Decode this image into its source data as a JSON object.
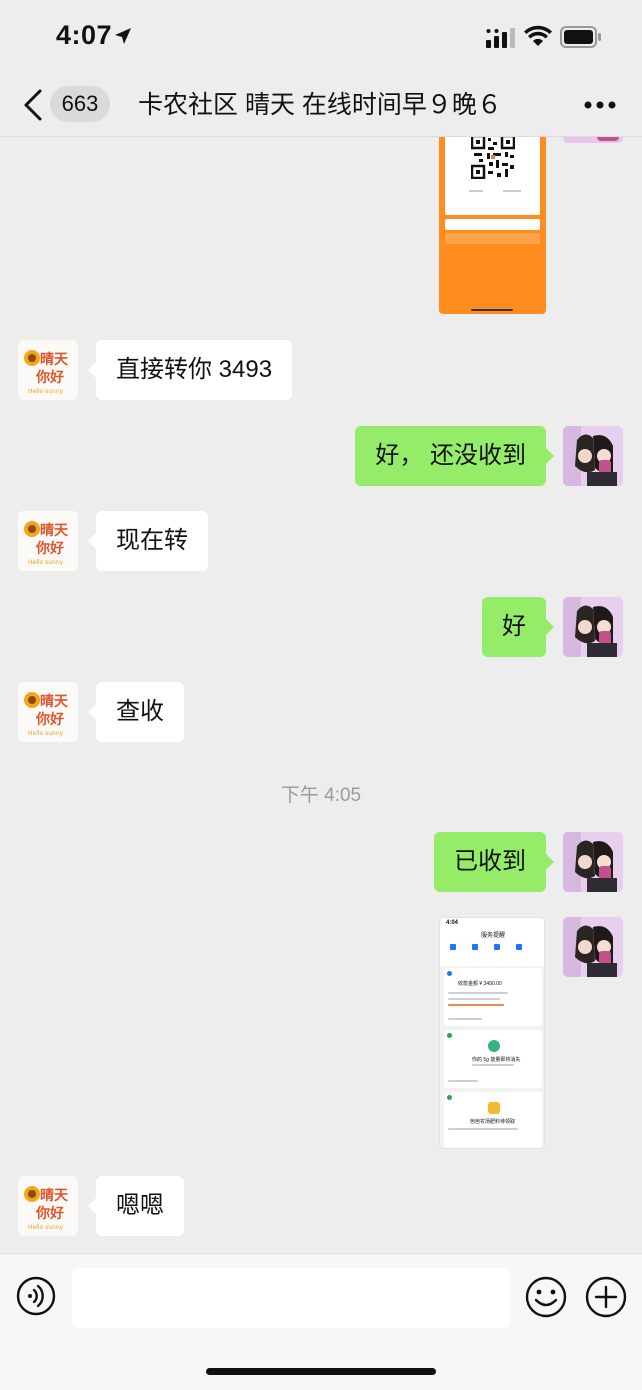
{
  "status_bar": {
    "time": "4:07"
  },
  "nav": {
    "unread_count": "663",
    "title": "卡农社区 晴天 在线时间早９晚６"
  },
  "avatar_text": {
    "line1": "晴天",
    "line2": "你好",
    "line3": "Hello sunny"
  },
  "messages": [
    {
      "side": "in",
      "text": "直接转你 3493"
    },
    {
      "side": "out",
      "text": "好， 还没收到"
    },
    {
      "side": "in",
      "text": "现在转"
    },
    {
      "side": "out",
      "text": "好"
    },
    {
      "side": "in",
      "text": "查收"
    },
    {
      "side": "out",
      "text": "已收到"
    },
    {
      "side": "in",
      "text": "嗯嗯"
    }
  ],
  "timestamp": "下午 4:05",
  "shared_screenshot": {
    "time": "4:04",
    "title": "服务提醒",
    "amount": "收款金额 ¥ 3490.00",
    "card2": "你的 5g 能量即将消失",
    "card3": "芭芭农场肥料待领取"
  },
  "colors": {
    "background": "#ededed",
    "outgoing_bubble": "#95ec69",
    "incoming_bubble": "#ffffff",
    "orange": "#ff8c1f"
  }
}
